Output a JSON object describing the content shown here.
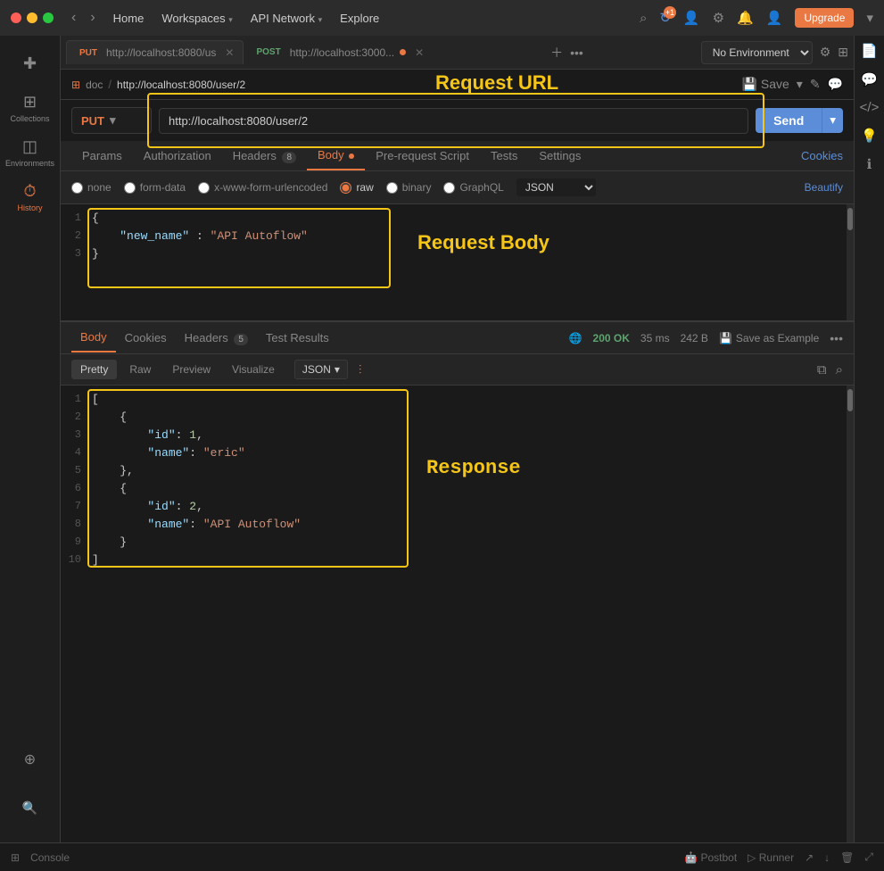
{
  "titlebar": {
    "nav": {
      "back": "‹",
      "forward": "›"
    },
    "links": [
      {
        "label": "Home",
        "active": false
      },
      {
        "label": "Workspaces",
        "active": false,
        "arrow": true
      },
      {
        "label": "API Network",
        "active": false,
        "arrow": true
      },
      {
        "label": "Explore",
        "active": false
      }
    ],
    "icons": {
      "search": "⌕",
      "sync": "↻",
      "sync_badge": "+1",
      "user_add": "👤+",
      "settings": "⚙",
      "bell": "🔔",
      "account": "👤"
    },
    "upgrade_label": "Upgrade"
  },
  "sidebar": {
    "items": [
      {
        "id": "new",
        "icon": "✚",
        "label": "New",
        "active": false
      },
      {
        "id": "collections",
        "icon": "⊞",
        "label": "Collections",
        "active": false
      },
      {
        "id": "environments",
        "icon": "◫",
        "label": "Environments",
        "active": false
      },
      {
        "id": "history",
        "icon": "⏱",
        "label": "History",
        "active": true
      }
    ],
    "bottom_items": [
      {
        "id": "explorer",
        "icon": "⊕",
        "label": ""
      },
      {
        "id": "find",
        "icon": "🔍",
        "label": ""
      }
    ]
  },
  "tabs": [
    {
      "method": "PUT",
      "method_class": "put",
      "url": "http://localhost:8080/us",
      "active": true,
      "dot": false
    },
    {
      "method": "POST",
      "method_class": "post",
      "url": "http://localhost:3000...",
      "active": false,
      "dot": true
    }
  ],
  "breadcrumb": {
    "icon": "⊞",
    "parts": [
      "doc",
      "http://localhost:8080/user/2"
    ]
  },
  "request": {
    "method": "PUT",
    "url": "http://localhost:8080/user/2",
    "send_label": "Send",
    "tabs": [
      {
        "label": "Params",
        "active": false
      },
      {
        "label": "Authorization",
        "active": false
      },
      {
        "label": "Headers",
        "badge": "8",
        "active": false
      },
      {
        "label": "Body",
        "dot": true,
        "active": true
      },
      {
        "label": "Pre-request Script",
        "active": false
      },
      {
        "label": "Tests",
        "active": false
      },
      {
        "label": "Settings",
        "active": false
      }
    ],
    "cookies_label": "Cookies",
    "body_options": [
      {
        "label": "none",
        "value": "none"
      },
      {
        "label": "form-data",
        "value": "form-data"
      },
      {
        "label": "x-www-form-urlencoded",
        "value": "x-www-form-urlencoded"
      },
      {
        "label": "raw",
        "value": "raw",
        "active": true
      },
      {
        "label": "binary",
        "value": "binary"
      },
      {
        "label": "GraphQL",
        "value": "graphql"
      }
    ],
    "format": "JSON",
    "beautify": "Beautify",
    "body_lines": [
      {
        "num": 1,
        "content": "{",
        "type": "brace"
      },
      {
        "num": 2,
        "content": "    \"new_name\" : \"API Autoflow\"",
        "type": "keyval"
      },
      {
        "num": 3,
        "content": "}",
        "type": "brace"
      }
    ],
    "annotation_url_label": "Request URL",
    "annotation_body_label": "Request Body"
  },
  "response": {
    "tabs": [
      {
        "label": "Body",
        "active": true
      },
      {
        "label": "Cookies",
        "active": false
      },
      {
        "label": "Headers",
        "badge": "5",
        "active": false
      },
      {
        "label": "Test Results",
        "active": false
      }
    ],
    "status": "200 OK",
    "time": "35 ms",
    "size": "242 B",
    "save_example": "Save as Example",
    "view_tabs": [
      {
        "label": "Pretty",
        "active": true
      },
      {
        "label": "Raw",
        "active": false
      },
      {
        "label": "Preview",
        "active": false
      },
      {
        "label": "Visualize",
        "active": false
      }
    ],
    "format": "JSON",
    "annotation_label": "Response",
    "lines": [
      {
        "num": 1,
        "content": "["
      },
      {
        "num": 2,
        "content": "    {"
      },
      {
        "num": 3,
        "content": "        \"id\": 1,"
      },
      {
        "num": 4,
        "content": "        \"name\": \"eric\""
      },
      {
        "num": 5,
        "content": "    },"
      },
      {
        "num": 6,
        "content": "    {"
      },
      {
        "num": 7,
        "content": "        \"id\": 2,"
      },
      {
        "num": 8,
        "content": "        \"name\": \"API Autoflow\""
      },
      {
        "num": 9,
        "content": "    }"
      },
      {
        "num": 10,
        "content": "]"
      }
    ]
  },
  "bottom_bar": {
    "postbot": "🤖 Postbot",
    "runner": "▷ Runner",
    "console_label": "Console"
  }
}
